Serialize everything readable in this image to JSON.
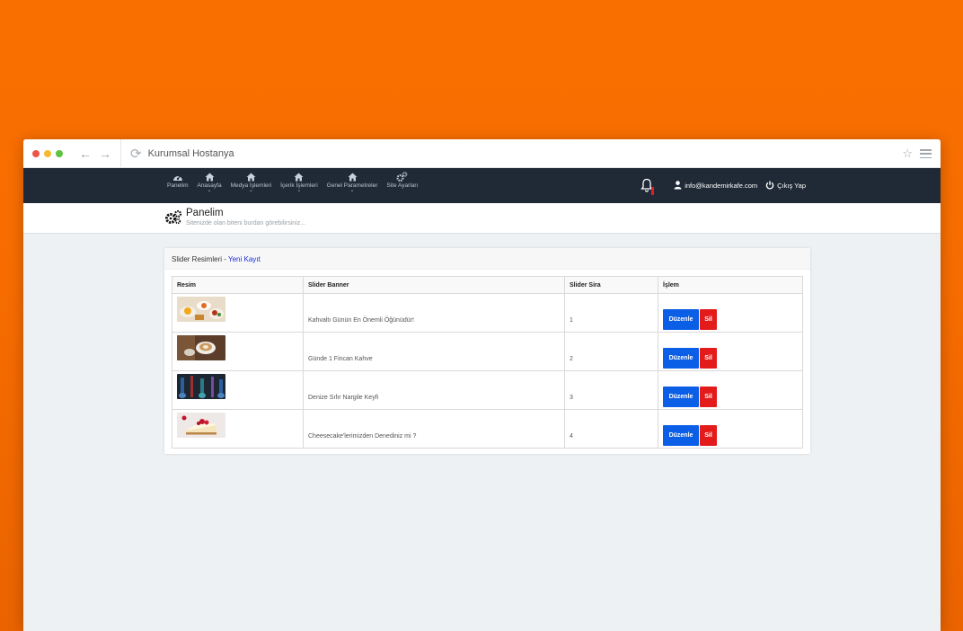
{
  "window": {
    "title": "Kurumsal Hostanya"
  },
  "colors": {
    "accent": "#0b5ee6",
    "danger": "#e31b1b",
    "navbar": "#1f2a36",
    "background": "#fa7000"
  },
  "nav": {
    "items": [
      {
        "label": "Panelim",
        "icon": "dashboard-icon",
        "dropdown": false
      },
      {
        "label": "Anasayfa",
        "icon": "home-icon",
        "dropdown": true
      },
      {
        "label": "Medya İşlemleri",
        "icon": "home-icon",
        "dropdown": true
      },
      {
        "label": "İçerik İşlemleri",
        "icon": "home-icon",
        "dropdown": true
      },
      {
        "label": "Genel Parametreler",
        "icon": "home-icon",
        "dropdown": true
      },
      {
        "label": "Site Ayarları",
        "icon": "cogs-icon",
        "dropdown": false
      }
    ],
    "user_email": "info@kandemirkafe.com",
    "logout_label": "Çıkış Yap"
  },
  "page": {
    "title": "Panelim",
    "subtitle": "Sitenizde olan biteni burdan görebilirsiniz..."
  },
  "card": {
    "title": "Slider Resimleri - ",
    "new_link": "Yeni Kayıt"
  },
  "table": {
    "columns": [
      "Resim",
      "Slider Banner",
      "Slider Sira",
      "İşlem"
    ],
    "edit_label": "Düzenle",
    "delete_label": "Sil",
    "rows": [
      {
        "banner": "Kahvaltı Günün En Önemli Öğünüdür!",
        "order": "1"
      },
      {
        "banner": "Günde 1 Fincan Kahve",
        "order": "2"
      },
      {
        "banner": "Denize Sıfır Nargile Keyfi",
        "order": "3"
      },
      {
        "banner": "Cheesecake'lerimizden Denediniz mi ?",
        "order": "4"
      }
    ]
  }
}
